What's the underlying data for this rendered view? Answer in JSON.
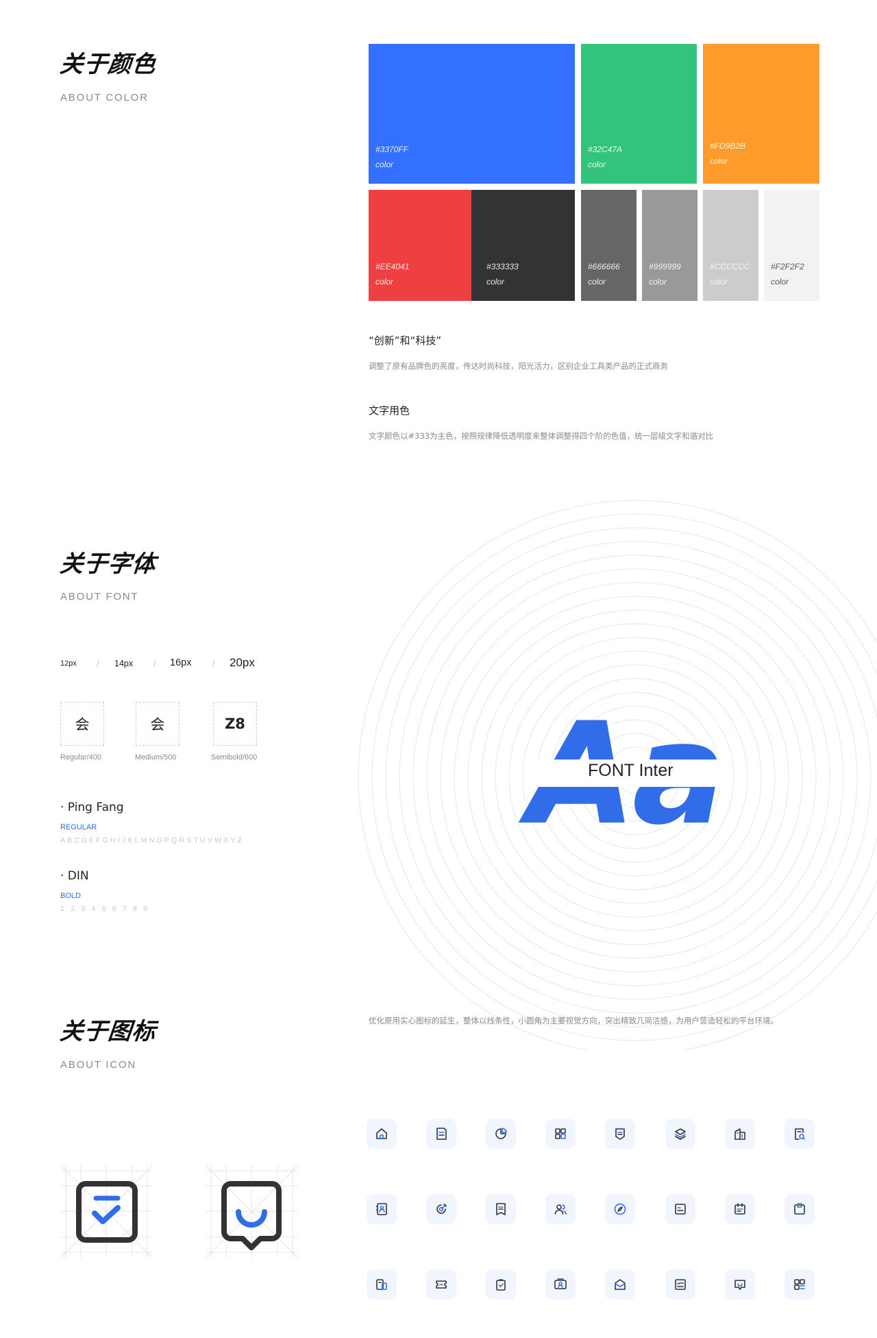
{
  "color_section": {
    "title": "关于颜色",
    "subtitle": "ABOUT COLOR",
    "swatches": [
      {
        "hex": "#3370FF",
        "label": "color"
      },
      {
        "hex": "#32C47A",
        "label": "color"
      },
      {
        "hex": "#FD9B2B",
        "label": "color"
      },
      {
        "hex": "#EE4041",
        "label": "color"
      },
      {
        "hex": "#333333",
        "label": "color"
      },
      {
        "hex": "#666666",
        "label": "color"
      },
      {
        "hex": "#999999",
        "label": "color"
      },
      {
        "hex": "#CCCCCC",
        "label": "color"
      },
      {
        "hex": "#F2F2F2",
        "label": "color"
      }
    ],
    "notes": [
      {
        "title": "“创新”和“科技”",
        "text": "调整了原有品牌色的亮度，传达时尚科技，阳光活力，区别企业工具类产品的正式商务"
      },
      {
        "title": "文字用色",
        "text": "文字颜色以#333为主色，按照规律降低透明度来整体调整得四个阶的色值，统一层级文字和谐对比"
      }
    ]
  },
  "font_section": {
    "title": "关于字体",
    "subtitle": "ABOUT FONT",
    "sizes": [
      "12px",
      "14px",
      "16px",
      "20px"
    ],
    "separator": "/",
    "weights": [
      {
        "sample": "会",
        "label": "Regular/400"
      },
      {
        "sample": "会",
        "label": "Medium/500"
      },
      {
        "sample": "Z8",
        "label": "Semibold/600"
      }
    ],
    "families": [
      {
        "name": "· Ping Fang",
        "style": "REGULAR",
        "chars": "ABCDEFGHIJKLMNOPQRSTUVWXYZ"
      },
      {
        "name": "· DIN",
        "style": "BOLD",
        "chars": "1 2 3 4 5 6 7 8 9"
      }
    ],
    "hero_glyphs": "Aa",
    "hero_label": "FONT Inter"
  },
  "icon_section": {
    "title": "关于图标",
    "subtitle": "ABOUT ICON",
    "description": "优化原用实心图标的延生，整体以线条性，小圆角为主要视觉方向，突出精致几简洁感，为用户营造轻松的平台环境。",
    "icons": [
      "home-icon",
      "document-icon",
      "pie-chart-icon",
      "apps-icon",
      "shield-doc-icon",
      "layers-icon",
      "building-icon",
      "search-doc-icon",
      "contacts-icon",
      "target-icon",
      "bookmark-doc-icon",
      "users-icon",
      "compass-icon",
      "list-card-icon",
      "calendar-icon",
      "clipboard-icon",
      "device-icon",
      "ticket-icon",
      "check-clipboard-icon",
      "certificate-icon",
      "mail-open-icon",
      "checklist-icon",
      "message-icon",
      "qr-grid-icon"
    ]
  }
}
